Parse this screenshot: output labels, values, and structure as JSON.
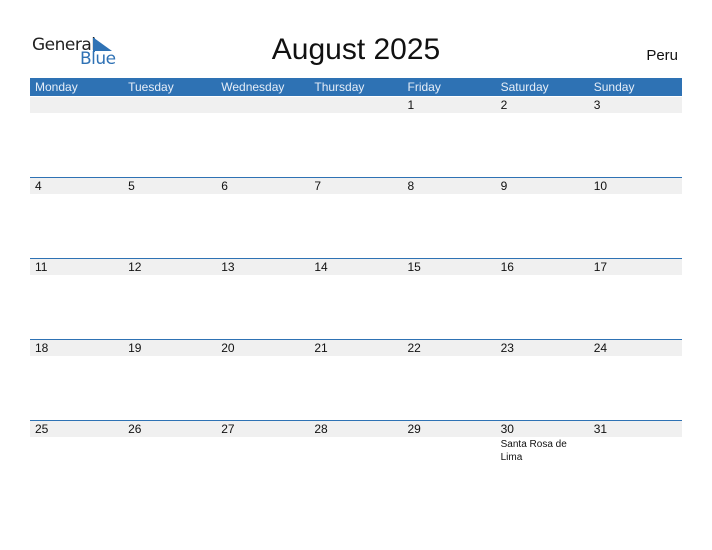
{
  "logo": {
    "line1": "General",
    "line2": "Blue"
  },
  "title": "August 2025",
  "country": "Peru",
  "weekdays": [
    "Monday",
    "Tuesday",
    "Wednesday",
    "Thursday",
    "Friday",
    "Saturday",
    "Sunday"
  ],
  "weeks": [
    {
      "days": [
        "",
        "",
        "",
        "",
        "1",
        "2",
        "3"
      ],
      "notes": [
        "",
        "",
        "",
        "",
        "",
        "",
        ""
      ]
    },
    {
      "days": [
        "4",
        "5",
        "6",
        "7",
        "8",
        "9",
        "10"
      ],
      "notes": [
        "",
        "",
        "",
        "",
        "",
        "",
        ""
      ]
    },
    {
      "days": [
        "11",
        "12",
        "13",
        "14",
        "15",
        "16",
        "17"
      ],
      "notes": [
        "",
        "",
        "",
        "",
        "",
        "",
        ""
      ]
    },
    {
      "days": [
        "18",
        "19",
        "20",
        "21",
        "22",
        "23",
        "24"
      ],
      "notes": [
        "",
        "",
        "",
        "",
        "",
        "",
        ""
      ]
    },
    {
      "days": [
        "25",
        "26",
        "27",
        "28",
        "29",
        "30",
        "31"
      ],
      "notes": [
        "",
        "",
        "",
        "",
        "",
        "Santa Rosa de Lima",
        ""
      ]
    }
  ],
  "colors": {
    "accent": "#2e72b4",
    "band": "#f0f0f0"
  }
}
